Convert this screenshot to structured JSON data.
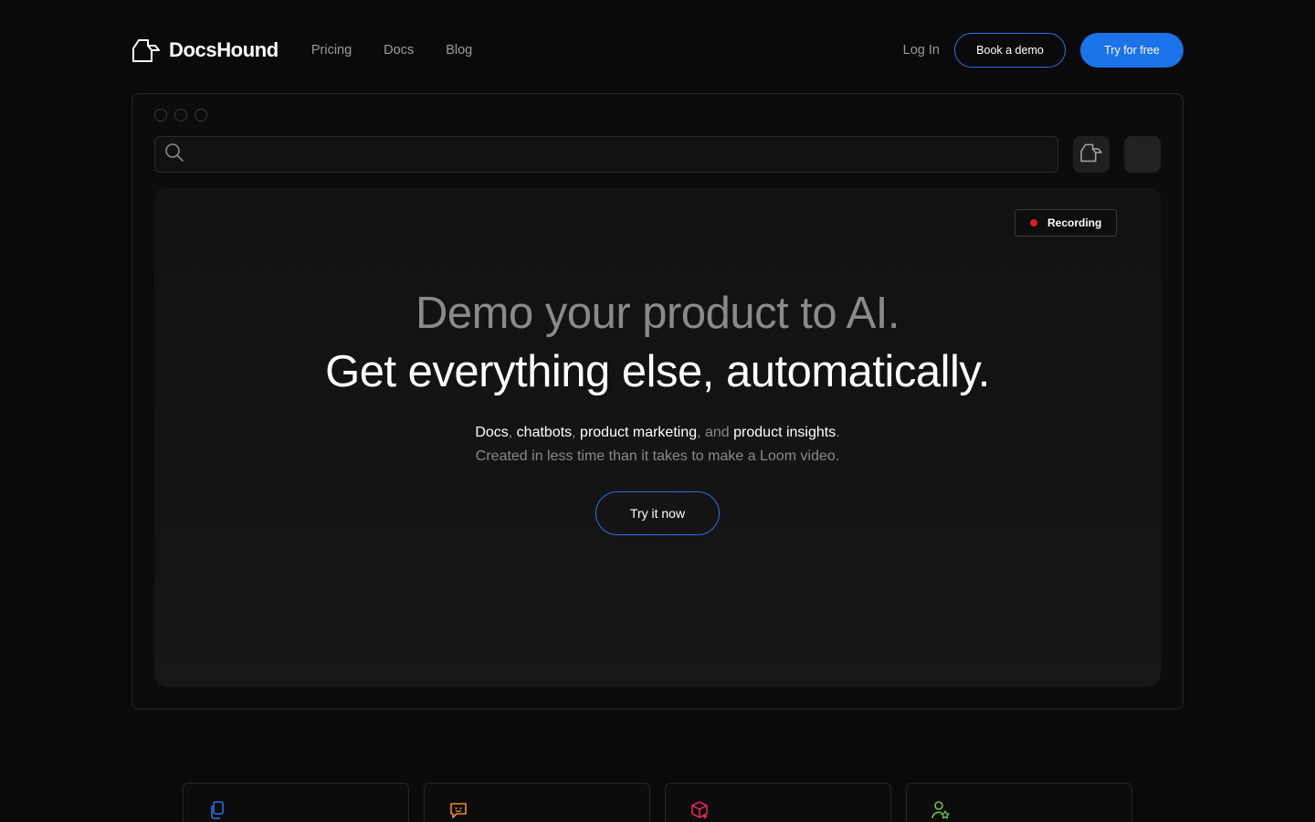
{
  "brand": {
    "name": "DocsHound"
  },
  "nav": {
    "links": [
      "Pricing",
      "Docs",
      "Blog"
    ],
    "login": "Log In",
    "book_demo": "Book a demo",
    "try_free": "Try for free"
  },
  "app": {
    "recording_label": "Recording",
    "headline_primary": "Demo your product to AI.",
    "headline_secondary": "Get everything else, automatically.",
    "subline": {
      "docs": "Docs",
      "sep1": ", ",
      "chatbots": "chatbots",
      "sep2": ", ",
      "product_marketing": "product marketing",
      "sep3": ", and ",
      "product_insights": "product insights",
      "end": "."
    },
    "subline2": "Created in less time than it takes to make a Loom video.",
    "cta": "Try it now"
  },
  "colors": {
    "background": "#0a0a0a",
    "accent": "#1a73e8",
    "recording": "#d91f26",
    "docs_icon": "#2f6fe0",
    "chat_icon": "#f08a24",
    "box_icon": "#e0245e",
    "user_icon": "#6cc04a"
  },
  "feature_icons": [
    "docs-icon",
    "chatbot-icon",
    "product-marketing-icon",
    "product-insights-icon"
  ]
}
